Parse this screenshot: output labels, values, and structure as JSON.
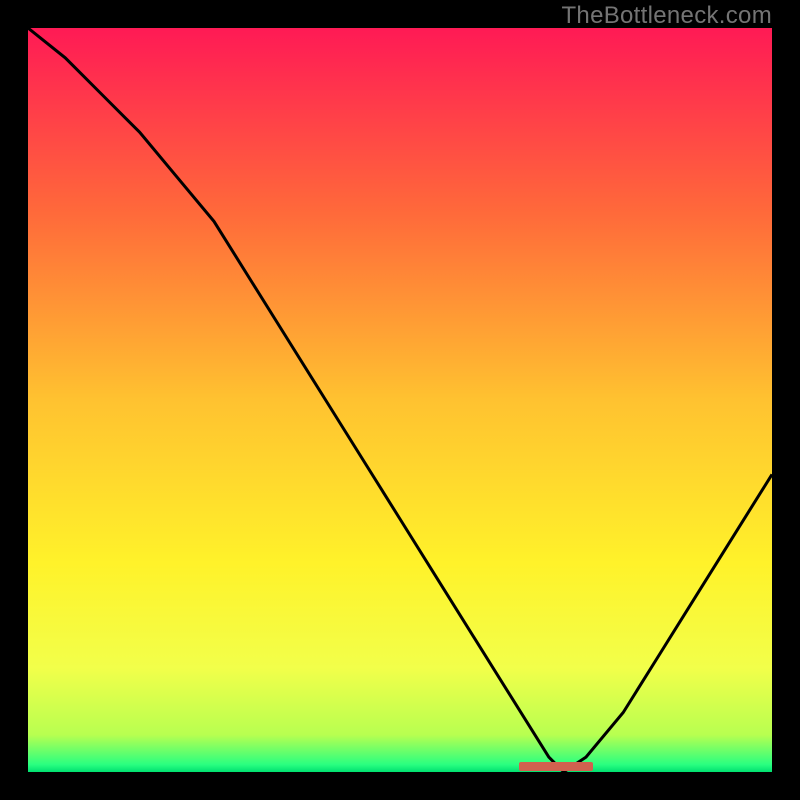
{
  "watermark": "TheBottleneck.com",
  "chart_data": {
    "type": "line",
    "title": "",
    "xlabel": "",
    "ylabel": "",
    "xlim": [
      0,
      100
    ],
    "ylim": [
      0,
      100
    ],
    "grid": false,
    "x": [
      0,
      5,
      10,
      15,
      20,
      25,
      30,
      35,
      40,
      45,
      50,
      55,
      60,
      65,
      70,
      72,
      75,
      80,
      85,
      90,
      95,
      100
    ],
    "values": [
      100,
      96,
      91,
      86,
      80,
      74,
      66,
      58,
      50,
      42,
      34,
      26,
      18,
      10,
      2,
      0,
      2,
      8,
      16,
      24,
      32,
      40
    ],
    "gradient_stops": [
      {
        "pos": 0.0,
        "color": "#ff1a55"
      },
      {
        "pos": 0.25,
        "color": "#ff6a3a"
      },
      {
        "pos": 0.5,
        "color": "#ffc230"
      },
      {
        "pos": 0.72,
        "color": "#fff22a"
      },
      {
        "pos": 0.86,
        "color": "#f2ff4a"
      },
      {
        "pos": 0.95,
        "color": "#b8ff50"
      },
      {
        "pos": 0.99,
        "color": "#2aff80"
      },
      {
        "pos": 1.0,
        "color": "#00e070"
      }
    ],
    "marker": {
      "x_start": 66,
      "x_end": 76,
      "y": 0,
      "color": "#d1614f"
    }
  }
}
